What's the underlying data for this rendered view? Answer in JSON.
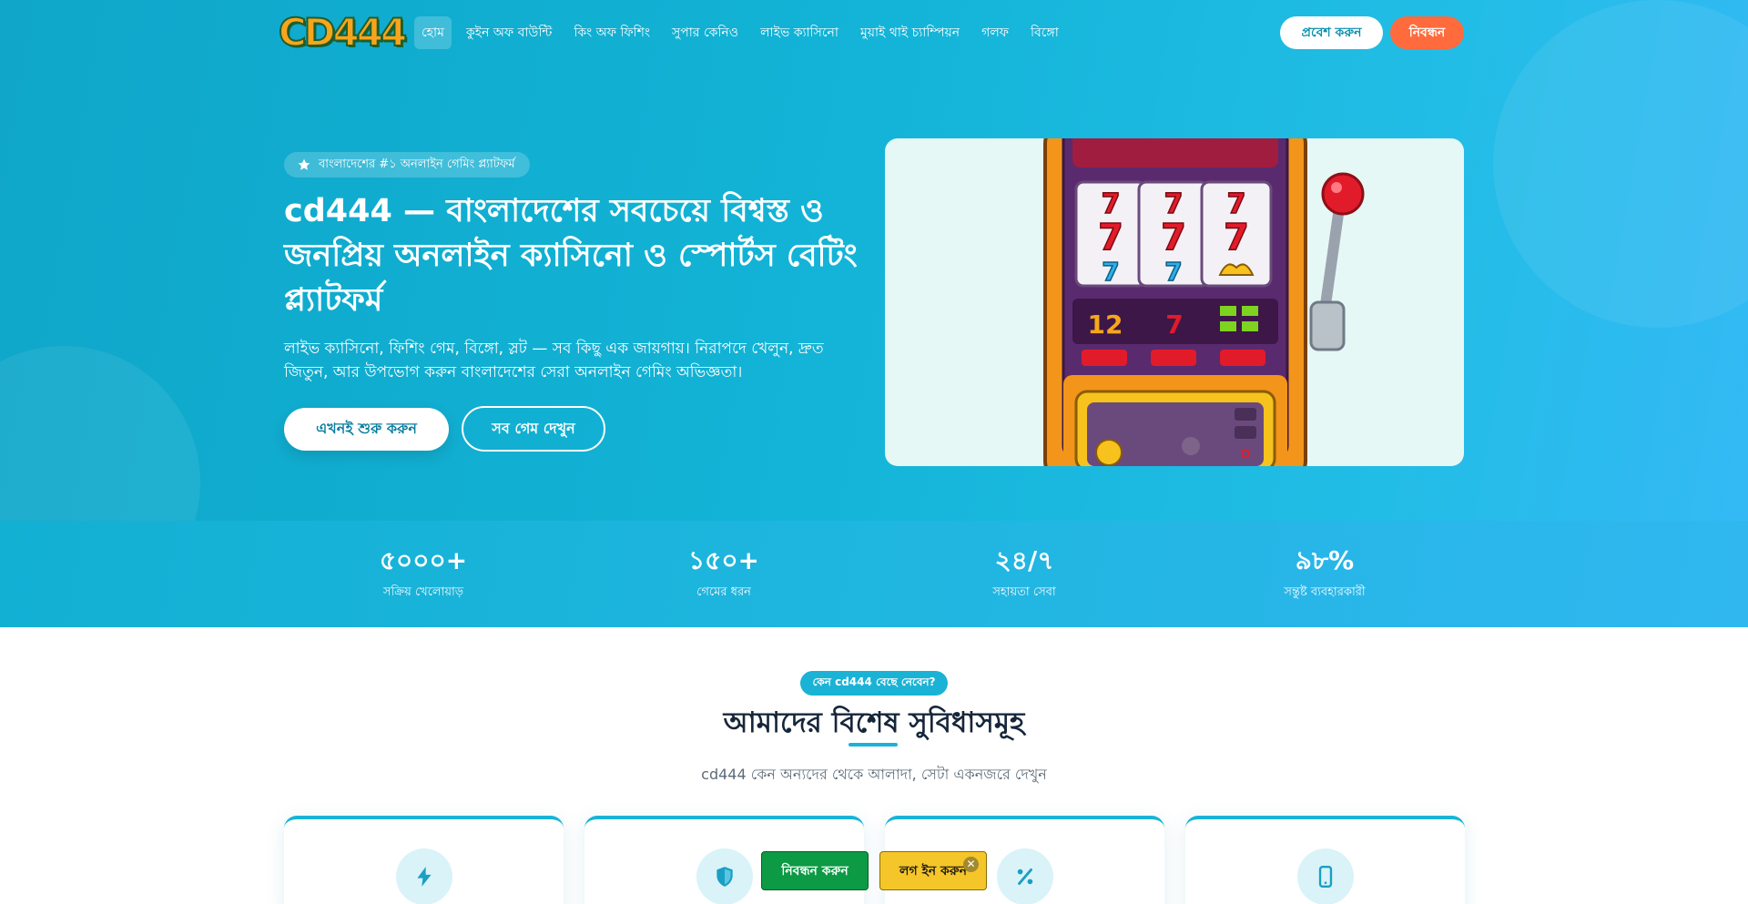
{
  "header": {
    "logo_text": "CD444",
    "nav": [
      "হোম",
      "কুইন অফ বাউন্টি",
      "কিং অফ ফিশিং",
      "সুপার কেনিও",
      "লাইভ ক্যাসিনো",
      "মুয়াই থাই চ্যাম্পিয়ন",
      "গলফ",
      "বিঙ্গো"
    ],
    "active_nav": "হোম",
    "login_label": "প্রবেশ করুন",
    "register_label": "নিবন্ধন"
  },
  "hero": {
    "badge": "বাংলাদেশের #১ অনলাইন গেমিং প্ল্যাটফর্ম",
    "title": "cd444 — বাংলাদেশের সবচেয়ে বিশ্বস্ত ও জনপ্রিয় অনলাইন ক্যাসিনো ও স্পোর্টস বেটিং প্ল্যাটফর্ম",
    "description": "লাইভ ক্যাসিনো, ফিশিং গেম, বিঙ্গো, স্লট — সব কিছু এক জায়গায়। নিরাপদে খেলুন, দ্রুত জিতুন, আর উপভোগ করুন বাংলাদেশের সেরা অনলাইন গেমিং অভিজ্ঞতা।",
    "cta_primary": "এখনই শুরু করুন",
    "cta_secondary": "সব গেম দেখুন",
    "slot_reels": [
      "7",
      "7",
      "7"
    ],
    "slot_display": "12"
  },
  "stats": [
    {
      "value": "৫০০০+",
      "label": "সক্রিয় খেলোয়াড়"
    },
    {
      "value": "১৫০+",
      "label": "গেমের ধরন"
    },
    {
      "value": "২৪/৭",
      "label": "সহায়তা সেবা"
    },
    {
      "value": "৯৮%",
      "label": "সন্তুষ্ট ব্যবহারকারী"
    }
  ],
  "features": {
    "pill": "কেন cd444 বেছে নেবেন?",
    "title": "আমাদের বিশেষ সুবিধাসমূহ",
    "subtitle": "cd444 কেন অন্যদের থেকে আলাদা, সেটা একনজরে দেখুন",
    "card_icons": [
      "lightning-icon",
      "shield-icon",
      "percent-icon",
      "mobile-icon"
    ]
  },
  "floating_bar": {
    "register_label": "নিবন্ধন করুন",
    "login_label": "লগ ইন করুন",
    "close_symbol": "✕"
  },
  "colors": {
    "accent": "#1ab3d6",
    "register_orange": "#ff6b3d",
    "float_green": "#0c9a44",
    "float_yellow": "#f5c629",
    "title_dark": "#16263a"
  }
}
